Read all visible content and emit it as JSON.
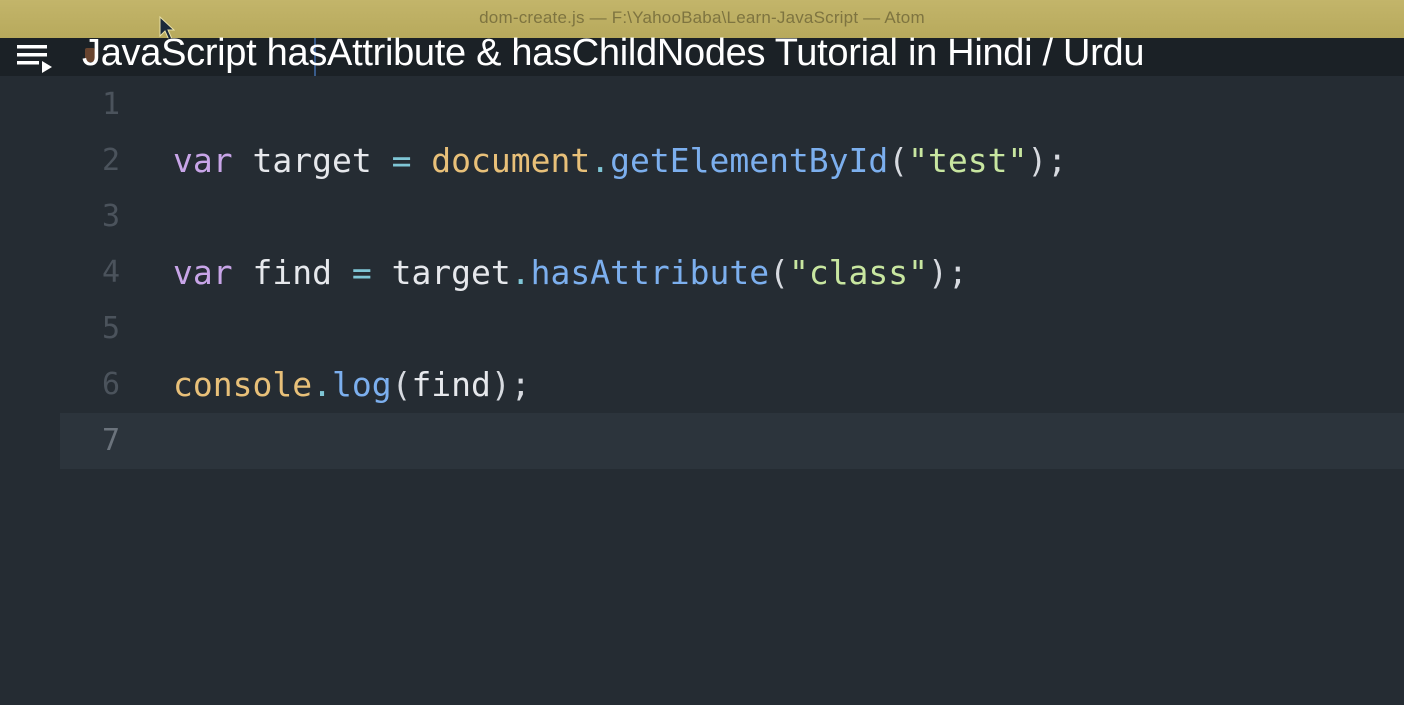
{
  "window": {
    "title": "dom-create.js — F:\\YahooBaba\\Learn-JavaScript — Atom"
  },
  "video": {
    "title": "JavaScript hasAttribute & hasChildNodes Tutorial in Hindi / Urdu",
    "playlist_icon": "playlist-play-icon"
  },
  "editor": {
    "active_line": 7,
    "lines": [
      {
        "num": "1",
        "tokens": []
      },
      {
        "num": "2",
        "tokens": [
          {
            "t": "var",
            "c": "kw"
          },
          {
            "t": " target ",
            "c": "var"
          },
          {
            "t": "=",
            "c": "op"
          },
          {
            "t": " document",
            "c": "obj"
          },
          {
            "t": ".",
            "c": "op"
          },
          {
            "t": "getElementById",
            "c": "fn"
          },
          {
            "t": "(",
            "c": "punc"
          },
          {
            "t": "\"test\"",
            "c": "str"
          },
          {
            "t": ");",
            "c": "punc"
          }
        ]
      },
      {
        "num": "3",
        "tokens": []
      },
      {
        "num": "4",
        "tokens": [
          {
            "t": "var",
            "c": "kw"
          },
          {
            "t": " find ",
            "c": "var"
          },
          {
            "t": "=",
            "c": "op"
          },
          {
            "t": " target",
            "c": "var"
          },
          {
            "t": ".",
            "c": "op"
          },
          {
            "t": "hasAttribute",
            "c": "fn"
          },
          {
            "t": "(",
            "c": "punc"
          },
          {
            "t": "\"class\"",
            "c": "str"
          },
          {
            "t": ");",
            "c": "punc"
          }
        ]
      },
      {
        "num": "5",
        "tokens": []
      },
      {
        "num": "6",
        "tokens": [
          {
            "t": "console",
            "c": "obj"
          },
          {
            "t": ".",
            "c": "op"
          },
          {
            "t": "log",
            "c": "fn"
          },
          {
            "t": "(",
            "c": "punc"
          },
          {
            "t": "find",
            "c": "var"
          },
          {
            "t": ");",
            "c": "punc"
          }
        ]
      },
      {
        "num": "7",
        "tokens": []
      }
    ]
  },
  "colors": {
    "editor_bg": "#252c33",
    "titlebar_bg": "#b7a95c",
    "keyword": "#c8a5e8",
    "function": "#7cafee",
    "string": "#c8e6a0",
    "object": "#e8c079"
  }
}
